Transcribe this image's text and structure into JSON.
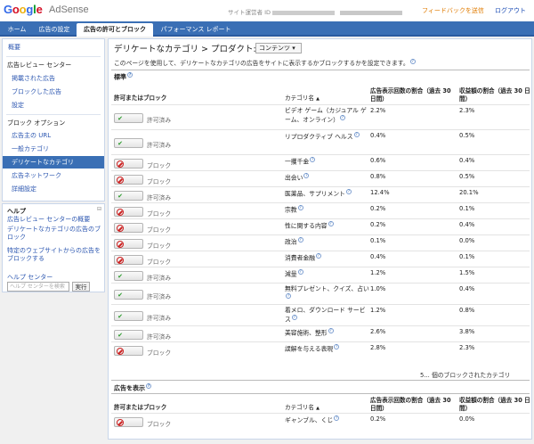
{
  "header": {
    "logo_word": "Google",
    "logo_product": "AdSense",
    "publisher_label": "サイト運営者 ID",
    "feedback": "フィードバックを送信",
    "logout": "ログアウト"
  },
  "nav": {
    "tabs": [
      {
        "label": "ホーム"
      },
      {
        "label": "広告の設定"
      },
      {
        "label": "広告の許可とブロック"
      },
      {
        "label": "パフォーマンス レポート"
      }
    ]
  },
  "sidebar": {
    "items": [
      {
        "label": "概要"
      },
      {
        "label": "広告レビュー センター"
      },
      {
        "label": "掲載された広告"
      },
      {
        "label": "ブロックした広告"
      },
      {
        "label": "設定"
      },
      {
        "label": "ブロック オプション"
      },
      {
        "label": "広告主の URL"
      },
      {
        "label": "一般カテゴリ"
      },
      {
        "label": "デリケートなカテゴリ"
      },
      {
        "label": "広告ネットワーク"
      },
      {
        "label": "詳細設定"
      }
    ]
  },
  "help": {
    "title": "ヘルプ",
    "links": [
      "広告レビュー センターの概要",
      "デリケートなカテゴリの広告のブロック",
      "特定のウェブサイトからの広告をブロックする"
    ],
    "center_label": "ヘルプ センター",
    "search_placeholder": "ヘルプ センターを検索",
    "search_button": "実行"
  },
  "main": {
    "title_part1": "デリケートなカテゴリ",
    "title_sep": " > ",
    "title_part2": "プロダクト:",
    "select_value": "コンテンツ",
    "description": "このページを使用して、デリケートなカテゴリの広告をサイトに表示するかブロックするかを設定できます。",
    "section_standard": "標準",
    "section_show": "広告を表示",
    "col_allow": "許可またはブロック",
    "col_category": "カテゴリ名",
    "col_category_sort": "▲",
    "col_impressions": "広告表示回数の割合（過去 30 日間）",
    "col_earnings": "収益額の割合（過去 30 日間）",
    "status_allowed": "許可済み",
    "status_blocked": "ブロック",
    "blocked_note": "5... 個のブロックされたカテゴリ",
    "rows": [
      {
        "state": "allowed",
        "category": "ビデオ ゲーム（カジュアル ゲーム、オンライン）",
        "impressions": "2.2%",
        "earnings": "2.3%"
      },
      {
        "state": "allowed",
        "category": "リプロダクティブ ヘルス",
        "impressions": "0.4%",
        "earnings": "0.5%"
      },
      {
        "state": "blocked",
        "category": "一攫千金",
        "impressions": "0.6%",
        "earnings": "0.4%"
      },
      {
        "state": "blocked",
        "category": "出会い",
        "impressions": "0.8%",
        "earnings": "0.5%"
      },
      {
        "state": "allowed",
        "category": "医薬品、サプリメント",
        "impressions": "12.4%",
        "earnings": "20.1%"
      },
      {
        "state": "blocked",
        "category": "宗教",
        "impressions": "0.2%",
        "earnings": "0.1%"
      },
      {
        "state": "blocked",
        "category": "性に関する内容",
        "impressions": "0.2%",
        "earnings": "0.4%"
      },
      {
        "state": "blocked",
        "category": "政治",
        "impressions": "0.1%",
        "earnings": "0.0%"
      },
      {
        "state": "blocked",
        "category": "消費者金融",
        "impressions": "0.4%",
        "earnings": "0.1%"
      },
      {
        "state": "allowed",
        "category": "減量",
        "impressions": "1.2%",
        "earnings": "1.5%"
      },
      {
        "state": "allowed",
        "category": "無料プレゼント、クイズ、占い",
        "impressions": "1.0%",
        "earnings": "0.4%"
      },
      {
        "state": "allowed",
        "category": "着メロ、ダウンロード サービス",
        "impressions": "1.2%",
        "earnings": "0.8%"
      },
      {
        "state": "allowed",
        "category": "美容施術、整形",
        "impressions": "2.6%",
        "earnings": "3.8%"
      },
      {
        "state": "blocked",
        "category": "誤解を与える表現",
        "impressions": "2.8%",
        "earnings": "2.3%"
      }
    ],
    "show_rows": [
      {
        "state": "blocked",
        "category": "ギャンブル、くじ",
        "impressions": "0.2%",
        "earnings": "0.0%"
      }
    ]
  }
}
